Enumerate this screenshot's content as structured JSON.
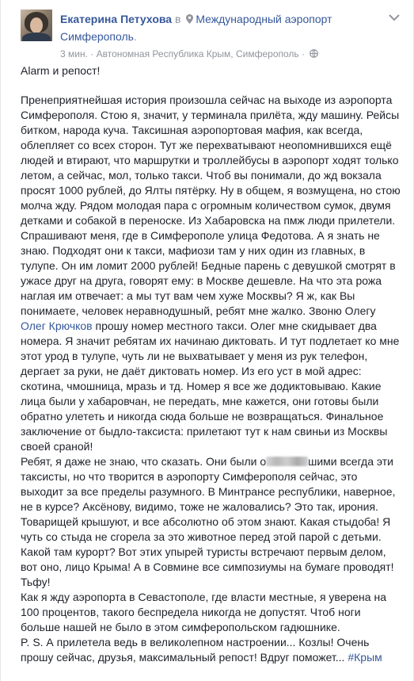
{
  "post": {
    "author": "Екатерина Петухова",
    "in_word": " в ",
    "place": "Международный аэропорт Симферополь",
    "place_suffix": ".",
    "time": "3 мин.",
    "meta_separator": " · ",
    "location": "Автономная Республика Крым, Симферополь",
    "icons": {
      "avatar": "profile-photo",
      "pin": "map-pin-icon",
      "globe": "globe-icon",
      "menu": "chevron-down-icon"
    }
  },
  "body": {
    "headline": "Alarm и репост!",
    "paragraph1_a": "Пренеприятнейшая история произошла сейчас на выходе из аэропорта Симферополя. Стою я, значит, у терминала прилёта, жду машину. Рейсы битком, народа куча. Таксишная аэропортовая мафия, как всегда, облепляет со всех сторон. Тут же перехватывают неопомнившихся ещё людей и втирают, что маршрутки и троллейбусы в аэропорт ходят только летом, а сейчас, мол, только такси. Чтоб вы понимали, до жд вокзала просят 1000 рублей, до Ялты пятёрку. Ну в общем, я возмущена, но стою молча жду. Рядом молодая пара с огромным количеством сумок, двумя детками и собакой в переноске. Из Хабаровска на пмж люди прилетели. Спрашивают меня, где в Симферополе улица Федотова. А я знать не знаю. Подходят они к такси, мафиози там у них один из главных, в тулупе. Он им ломит 2000 рублей! Бедные парень с девушкой смотрят в ужасе друг на друга, говорят ему: в Москве дешевле. На что эта рожа наглая им отвечает: а мы тут вам чем хуже Москвы? Я ж, как Вы понимаете, человек неравнодушный, ребят мне жалко. Звоню Олегу ",
    "mention": "Олег Крючков",
    "paragraph1_b": " прошу номер местного такси. Олег мне скидывает два номера. Я значит ребятам их начинаю диктовать. И тут подлетает ко мне этот урод в тулупе, чуть ли не выхватывает у меня из рук телефон, дергает за руки, не даёт диктовать номер. Из его уст в мой адрес: скотина, чмошница, мразь и тд. Номер я все же додиктовываю. Какие лица были у хабаровчан, не передать, мне кажется, они готовы были обратно улететь и никогда сюда больше не возвращаться. Финальное заключение от быдло-таксиста: прилетают тут к нам свиньи из Москвы своей сраной!",
    "paragraph2_a": "Ребят, я даже не знаю, что сказать. Они были о",
    "paragraph2_b": "шими всегда эти таксисты, но что творится в аэропорту Симферополя сейчас, это выходит за все пределы разумного. В Минтрансе республики, наверное, не в курсе? Аксёнову, видимо, тоже не жаловались? Это так, ирония. Товарищей крышуют, и все абсолютно об этом знают. Какая стыдоба! Я чуть со стыда не сгорела за это животное перед этой парой с детьми. Какой там курорт? Вот этих упырей туристы встречают первым делом, вот оно, лицо Крыма! А в Совмине все симпозиумы на бумаге проводят! Тьфу!",
    "paragraph3": "Как я жду аэропорта в Севастополе, где власти местные, я уверена на 100 процентов, такого беспредела никогда не допустят. Чтоб ноги больше нашей не было в этом симферопольском гадюшнике.",
    "paragraph4_a": "P. S. А прилетела ведь в великолепном настроении... Козлы! Очень прошу сейчас, друзья, максимальный репост! Вдруг поможет... ",
    "hashtag": "#Крым"
  },
  "colors": {
    "link": "#365899",
    "text": "#1d2129",
    "meta": "#90949c"
  }
}
